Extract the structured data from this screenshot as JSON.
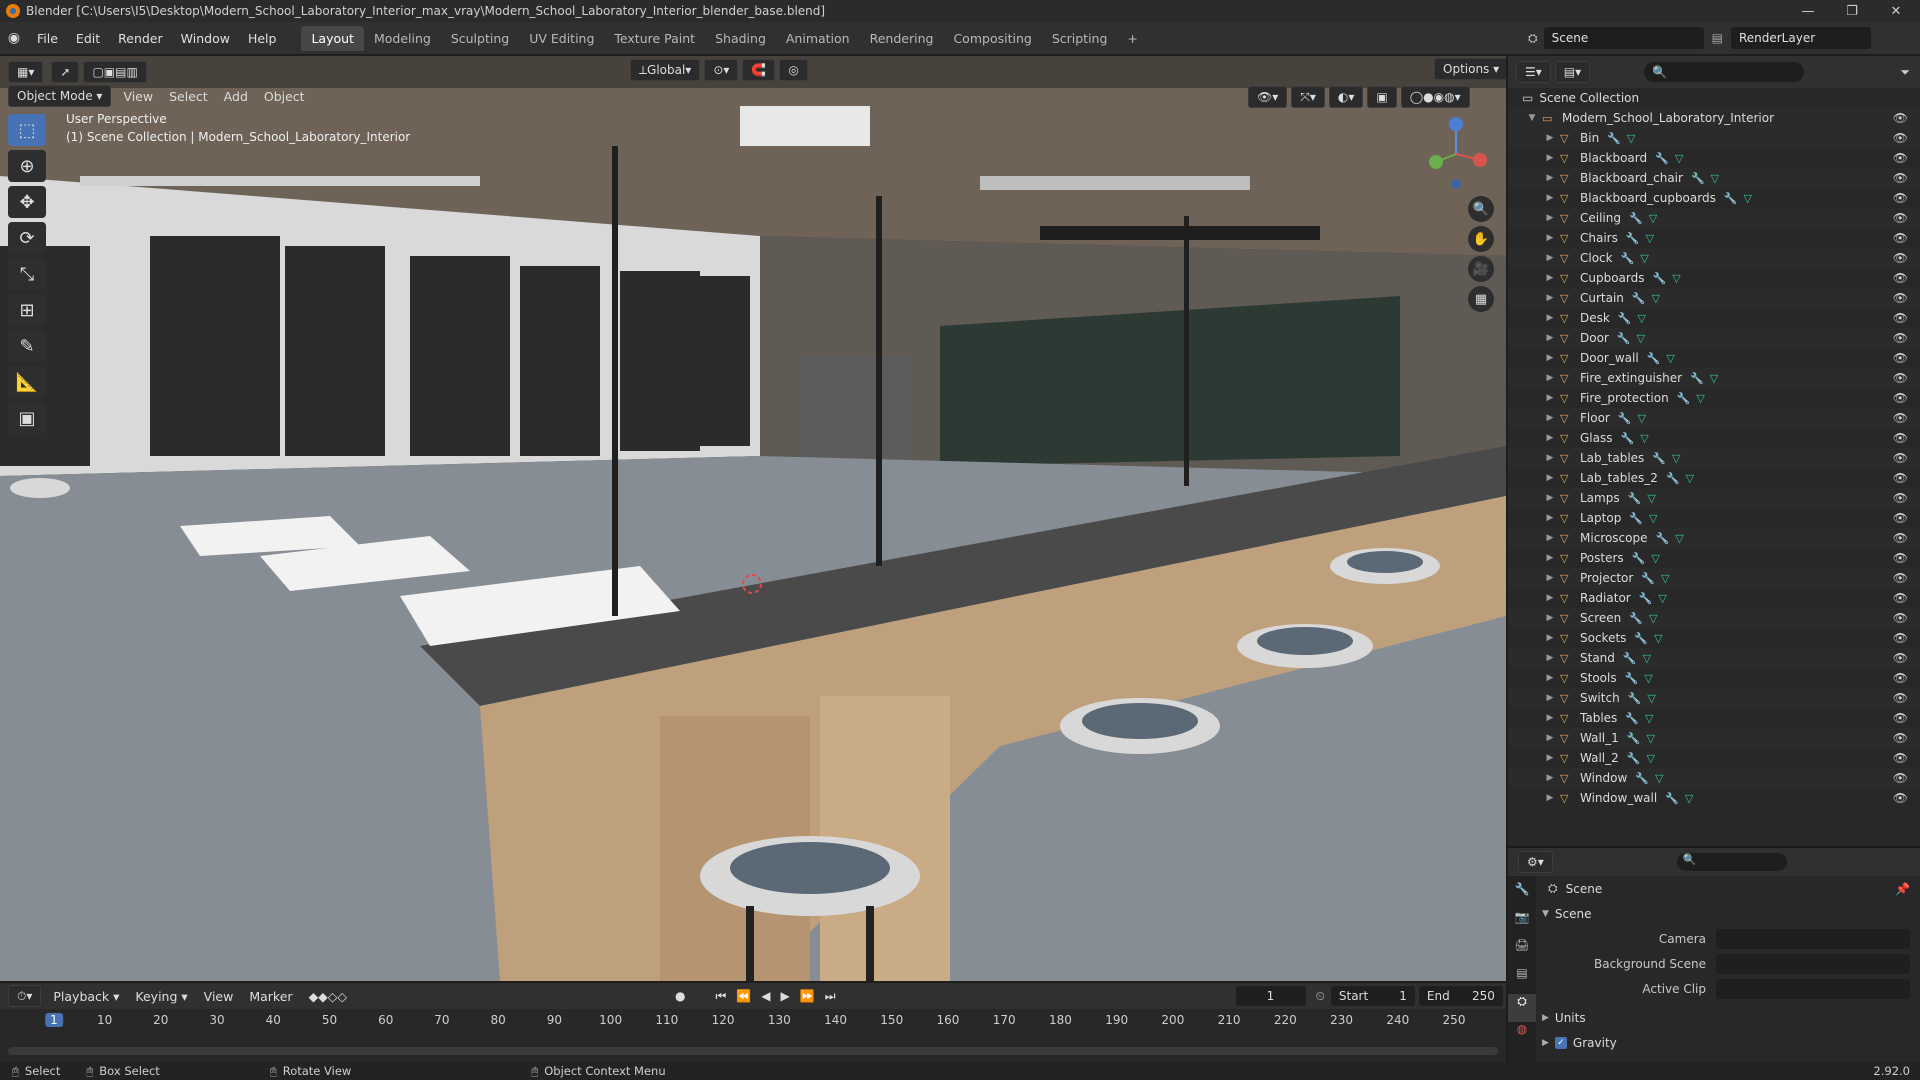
{
  "window": {
    "title": "Blender [C:\\Users\\I5\\Desktop\\Modern_School_Laboratory_Interior_max_vray\\Modern_School_Laboratory_Interior_blender_base.blend]"
  },
  "menu": [
    "File",
    "Edit",
    "Render",
    "Window",
    "Help"
  ],
  "workspaces": [
    "Layout",
    "Modeling",
    "Sculpting",
    "UV Editing",
    "Texture Paint",
    "Shading",
    "Animation",
    "Rendering",
    "Compositing",
    "Scripting"
  ],
  "scene": {
    "name": "Scene",
    "render_layer": "RenderLayer"
  },
  "viewport": {
    "mode": "Object Mode",
    "menus": [
      "View",
      "Select",
      "Add",
      "Object"
    ],
    "transform": "Global",
    "options": "Options",
    "overlay_line1": "User Perspective",
    "overlay_line2": "(1) Scene Collection | Modern_School_Laboratory_Interior"
  },
  "outliner": {
    "root": "Scene Collection",
    "collection": "Modern_School_Laboratory_Interior",
    "items": [
      "Bin",
      "Blackboard",
      "Blackboard_chair",
      "Blackboard_cupboards",
      "Ceiling",
      "Chairs",
      "Clock",
      "Cupboards",
      "Curtain",
      "Desk",
      "Door",
      "Door_wall",
      "Fire_extinguisher",
      "Fire_protection",
      "Floor",
      "Glass",
      "Lab_tables",
      "Lab_tables_2",
      "Lamps",
      "Laptop",
      "Microscope",
      "Posters",
      "Projector",
      "Radiator",
      "Screen",
      "Sockets",
      "Stand",
      "Stools",
      "Switch",
      "Tables",
      "Wall_1",
      "Wall_2",
      "Window",
      "Window_wall"
    ]
  },
  "properties": {
    "context": "Scene",
    "section": "Scene",
    "fields": [
      {
        "label": "Camera"
      },
      {
        "label": "Background Scene"
      },
      {
        "label": "Active Clip"
      }
    ],
    "units": "Units",
    "gravity": "Gravity"
  },
  "timeline": {
    "menus": [
      "Playback",
      "Keying",
      "View",
      "Marker"
    ],
    "current_frame": "1",
    "start_label": "Start",
    "start": "1",
    "end_label": "End",
    "end": "250",
    "ticks": [
      "1",
      "10",
      "20",
      "30",
      "40",
      "50",
      "60",
      "70",
      "80",
      "90",
      "100",
      "110",
      "120",
      "130",
      "140",
      "150",
      "160",
      "170",
      "180",
      "190",
      "200",
      "210",
      "220",
      "230",
      "240",
      "250"
    ]
  },
  "statusbar": {
    "select": "Select",
    "box_select": "Box Select",
    "rotate": "Rotate View",
    "context_menu": "Object Context Menu",
    "version": "2.92.0"
  }
}
